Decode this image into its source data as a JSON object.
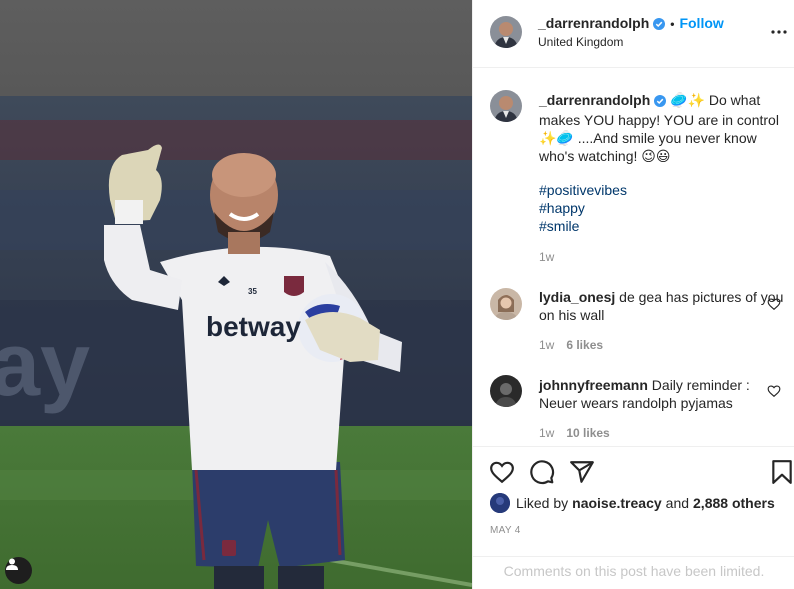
{
  "post": {
    "username": "_darrenrandolph",
    "follow_label": "Follow",
    "dot": "•",
    "location": "United Kingdom"
  },
  "caption": {
    "username": "_darrenrandolph",
    "text": "🥏✨ Do what makes YOU happy! YOU are in control ✨🥏 ....And smile you never know who's watching! 😉😃",
    "hashtags": [
      "#positivevibes",
      "#happy",
      "#smile"
    ],
    "time": "1w"
  },
  "comments": [
    {
      "username": "lydia_onesj",
      "text": "de gea has pictures of you on his wall",
      "time": "1w",
      "likes": "6 likes"
    },
    {
      "username": "johnnyfreemann",
      "text": "Daily reminder : Neuer wears randolph pyjamas",
      "time": "1w",
      "likes": "10 likes"
    }
  ],
  "likes": {
    "prefix": "Liked by",
    "user": "naoise.treacy",
    "and": "and",
    "others": "2,888 others"
  },
  "date": "MAY 4",
  "comments_limited": "Comments on this post have been limited.",
  "photo": {
    "shirt_sponsor": "betway",
    "shirt_number": "35"
  },
  "colors": {
    "accent": "#0095f6",
    "verified": "#3897f0",
    "hashtag": "#00376b",
    "muted": "#8e8e8e"
  },
  "icons": [
    "more-icon",
    "heart-icon",
    "comment-icon",
    "share-icon",
    "bookmark-icon",
    "user-tag-icon",
    "verified-icon"
  ]
}
